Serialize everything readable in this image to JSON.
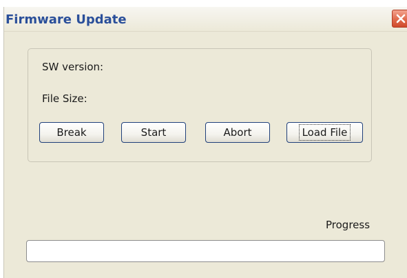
{
  "window": {
    "title": "Firmware Update"
  },
  "info": {
    "sw_version_label": "SW version:",
    "file_size_label": "File Size:"
  },
  "buttons": {
    "break_label": "Break",
    "start_label": "Start",
    "abort_label": "Abort",
    "load_file_label": "Load File"
  },
  "progress": {
    "label": "Progress",
    "value_percent": 0
  },
  "colors": {
    "title_text": "#2a4f9a",
    "window_bg": "#ece9d8",
    "close_button": "#e06a4c"
  },
  "icons": {
    "close": "close-icon"
  }
}
